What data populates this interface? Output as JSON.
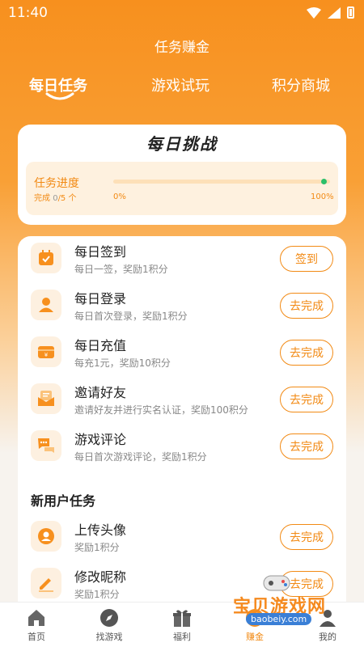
{
  "status_bar": {
    "time": "11:40"
  },
  "page_title": "任务赚金",
  "tabs": [
    {
      "label": "每日任务",
      "active": true
    },
    {
      "label": "游戏试玩",
      "active": false
    },
    {
      "label": "积分商城",
      "active": false
    }
  ],
  "challenge": {
    "title": "每日挑战",
    "progress_label": "任务进度",
    "completed_prefix": "完成",
    "completed": "0",
    "total_suffix": "/5 个",
    "progress_fraction": 0.0,
    "pct_min": "0%",
    "pct_max": "100%"
  },
  "daily_tasks": [
    {
      "icon": "calendar-check-icon",
      "title": "每日签到",
      "desc": "每日一签，奖励1积分",
      "button": "签到"
    },
    {
      "icon": "user-icon",
      "title": "每日登录",
      "desc": "每日首次登录，奖励1积分",
      "button": "去完成"
    },
    {
      "icon": "wallet-icon",
      "title": "每日充值",
      "desc": "每充1元，奖励10积分",
      "button": "去完成"
    },
    {
      "icon": "invite-mail-icon",
      "title": "邀请好友",
      "desc": "邀请好友并进行实名认证，奖励100积分",
      "button": "去完成"
    },
    {
      "icon": "comment-icon",
      "title": "游戏评论",
      "desc": "每日首次游戏评论，奖励1积分",
      "button": "去完成"
    }
  ],
  "new_user_section": "新用户任务",
  "new_user_tasks": [
    {
      "icon": "avatar-icon",
      "title": "上传头像",
      "desc": "奖励1积分",
      "button": "去完成"
    },
    {
      "icon": "edit-icon",
      "title": "修改昵称",
      "desc": "奖励1积分",
      "button": "去完成"
    }
  ],
  "watermark": {
    "text": "宝贝游戏网",
    "url": "baobeiy.com"
  },
  "bottom_nav": [
    {
      "icon": "home-icon",
      "label": "首页"
    },
    {
      "icon": "compass-icon",
      "label": "找游戏"
    },
    {
      "icon": "gift-icon",
      "label": "福利"
    },
    {
      "icon": "coin-icon",
      "label": "赚金",
      "active": true
    },
    {
      "icon": "profile-icon",
      "label": "我的"
    }
  ],
  "colors": {
    "accent": "#f28a14",
    "hero": "#f7901e",
    "success_dot": "#2bbf6a"
  }
}
